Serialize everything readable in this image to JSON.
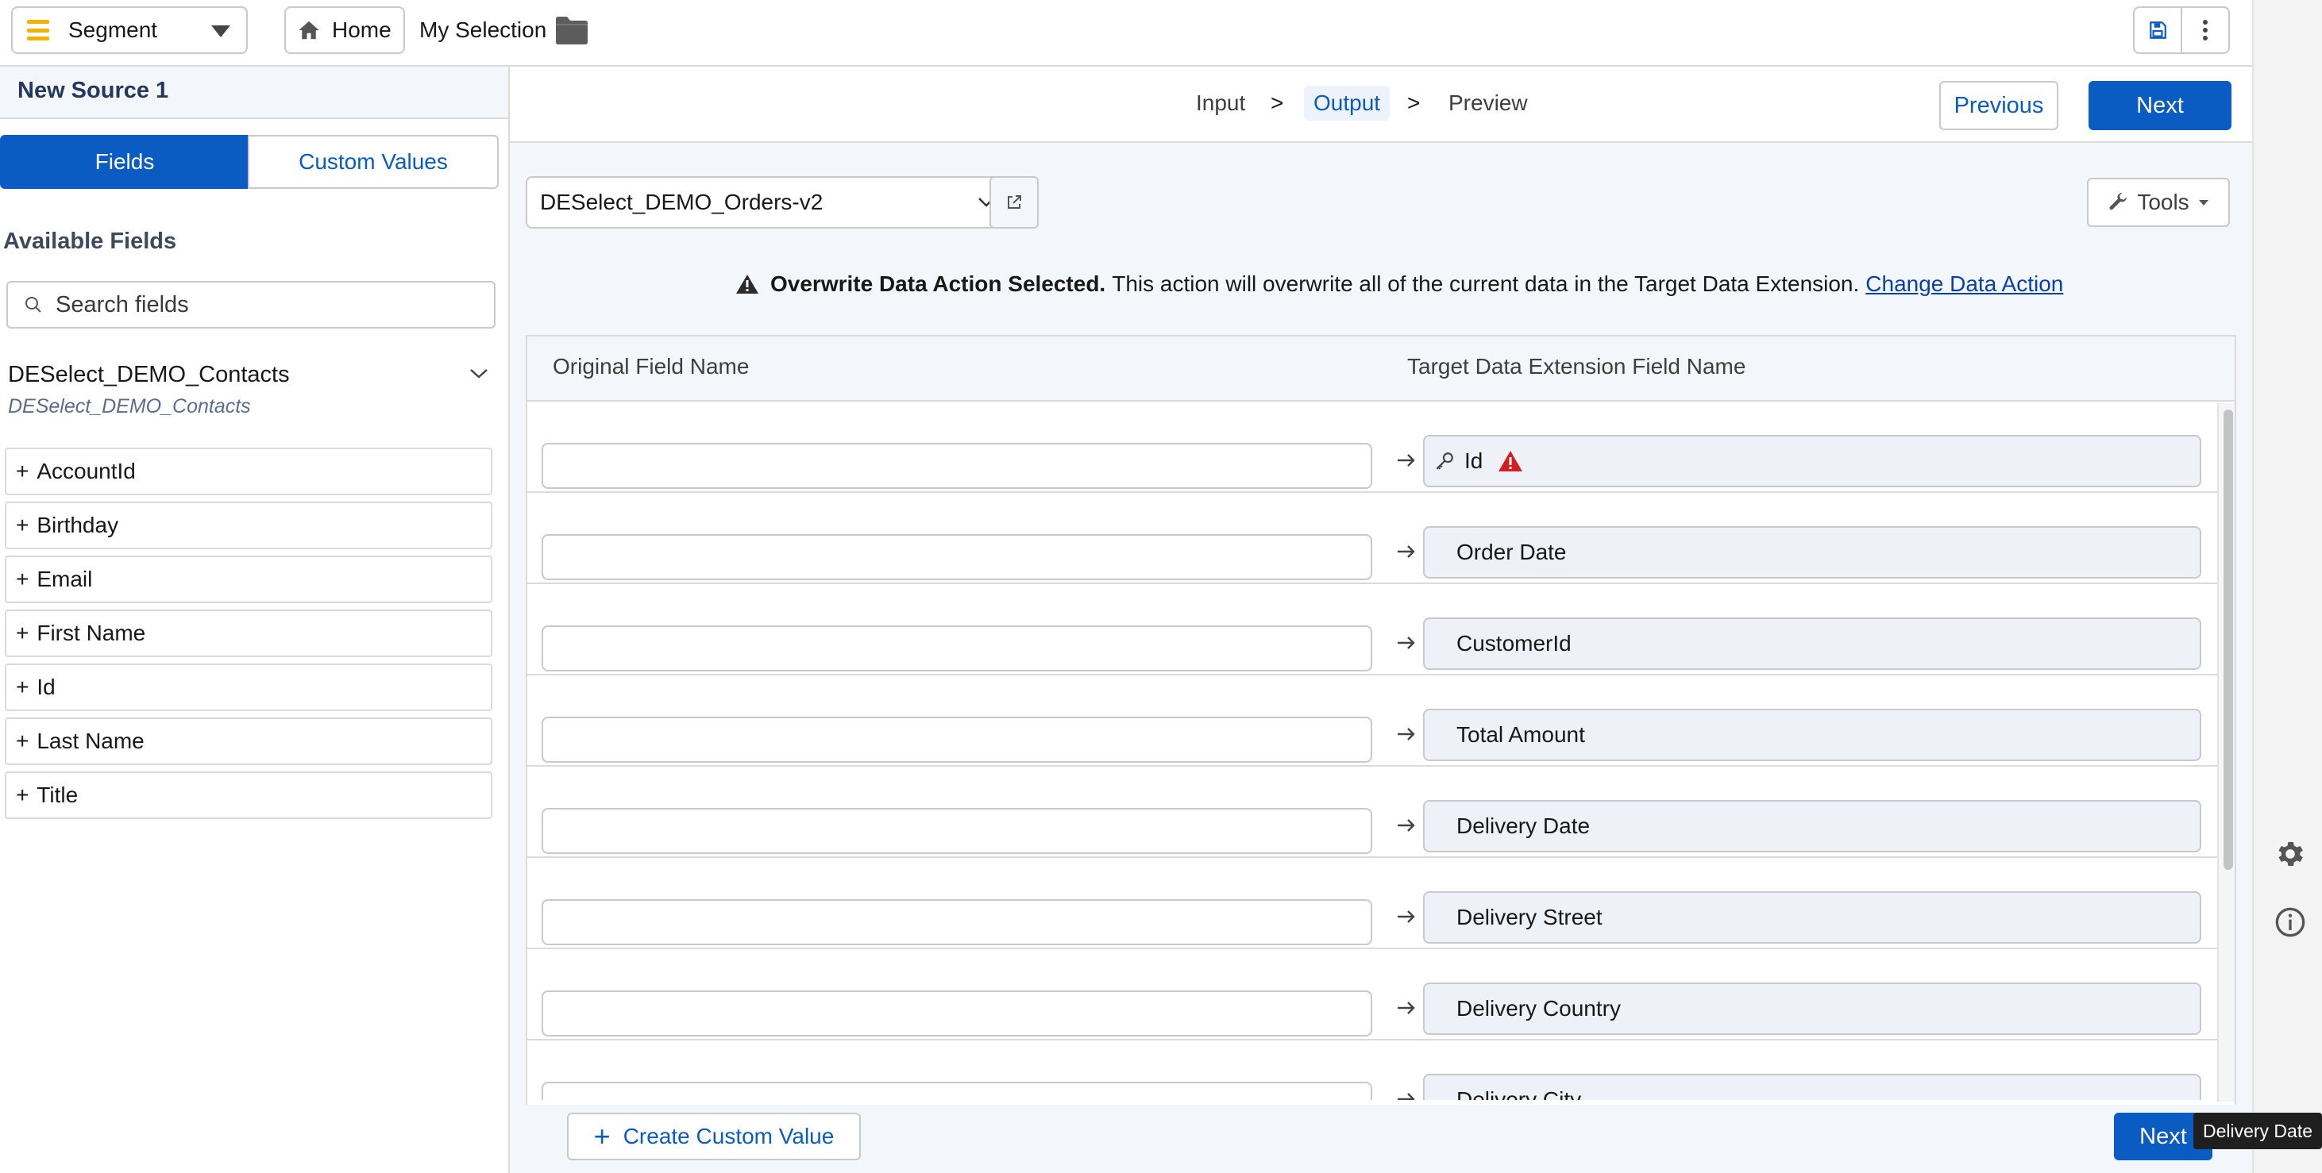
{
  "topbar": {
    "segment_label": "Segment",
    "home_label": "Home",
    "my_selection_label": "My Selection"
  },
  "left": {
    "source_name": "New Source 1",
    "tab_fields": "Fields",
    "tab_custom_values": "Custom Values",
    "available_title": "Available Fields",
    "search_placeholder": "Search fields",
    "de_name": "DESelect_DEMO_Contacts",
    "de_subtitle": "DESelect_DEMO_Contacts",
    "fields": [
      "AccountId",
      "Birthday",
      "Email",
      "First Name",
      "Id",
      "Last Name",
      "Title"
    ]
  },
  "steps": {
    "input": "Input",
    "output": "Output",
    "preview": "Preview",
    "sep": ">"
  },
  "nav": {
    "previous": "Previous",
    "next": "Next"
  },
  "target": {
    "selected_de": "DESelect_DEMO_Orders-v2",
    "tools_label": "Tools"
  },
  "warning": {
    "bold": "Overwrite Data Action Selected.",
    "text": "This action will overwrite all of the current data in the Target Data Extension.",
    "link": "Change Data Action"
  },
  "mapping": {
    "col_original": "Original Field Name",
    "col_target": "Target Data Extension Field Name",
    "rows": [
      "Id",
      "Order Date",
      "CustomerId",
      "Total Amount",
      "Delivery Date",
      "Delivery Street",
      "Delivery Country",
      "Delivery City"
    ]
  },
  "bottom": {
    "create_custom_value": "Create Custom Value",
    "next": "Next"
  },
  "tooltip": "Delivery Date",
  "colors": {
    "accent": "#0b5cc2",
    "warning_red": "#d11f1f",
    "brand_yellow": "#f2b200"
  }
}
